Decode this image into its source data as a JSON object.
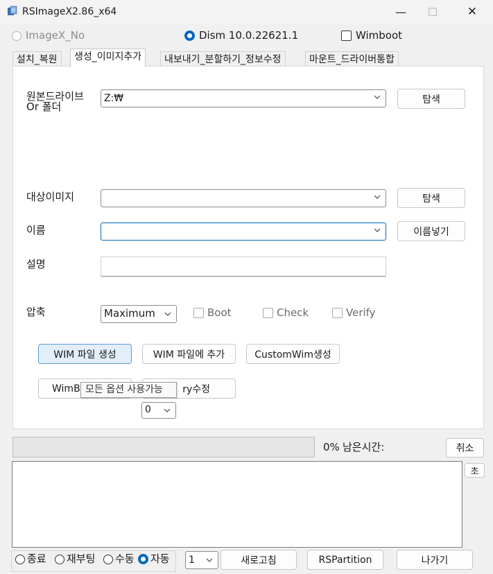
{
  "window": {
    "title": "RSImageX2.86_x64",
    "minimize_glyph": "—",
    "maximize_glyph": "☐",
    "close_glyph": "✕"
  },
  "mode": {
    "imagex_label": "ImageX_No",
    "dism_label": "Dism 10.0.22621.1",
    "wimboot_label": "Wimboot"
  },
  "tabs": [
    {
      "label": "설치_복원"
    },
    {
      "label": "생성_이미지추가"
    },
    {
      "label": "내보내기_분할하기_정보수정"
    },
    {
      "label": "마운트_드라이버통합"
    }
  ],
  "form": {
    "source_label": "원본드라이브\nOr 폴더",
    "source_value": "Z:₩",
    "browse_label": "탐색",
    "target_label": "대상이미지",
    "target_value": "",
    "target_browse_label": "탐색",
    "name_label": "이름",
    "name_value": "",
    "insert_name_label": "이름넣기",
    "desc_label": "설명",
    "desc_value": "",
    "compress_label": "압축",
    "compress_value": "Maximum",
    "boot_label": "Boot",
    "check_label": "Check",
    "verify_label": "Verify"
  },
  "actions": {
    "create_wim": "WIM 파일 생성",
    "append_wim": "WIM 파일에 추가",
    "custom_wim": "CustomWim생성",
    "wimboot_partial": "WimB",
    "registry_partial": "ry수정",
    "index_value": "0",
    "tooltip": "모든 옵션 사용가능"
  },
  "status": {
    "percent": "0%",
    "remaining_label": "남은시간:",
    "cancel_label": "취소",
    "seconds_label": "초",
    "progress_fraction": 0
  },
  "footer": {
    "exit_label": "종료",
    "reboot_label": "재부팅",
    "manual_label": "수동",
    "auto_label": "자동",
    "count_value": "1",
    "refresh_label": "새로고침",
    "rspartition_label": "RSPartition",
    "quit_label": "나가기"
  },
  "colors": {
    "accent": "#0067c0",
    "primary_button_bg": "#e2eef9"
  }
}
